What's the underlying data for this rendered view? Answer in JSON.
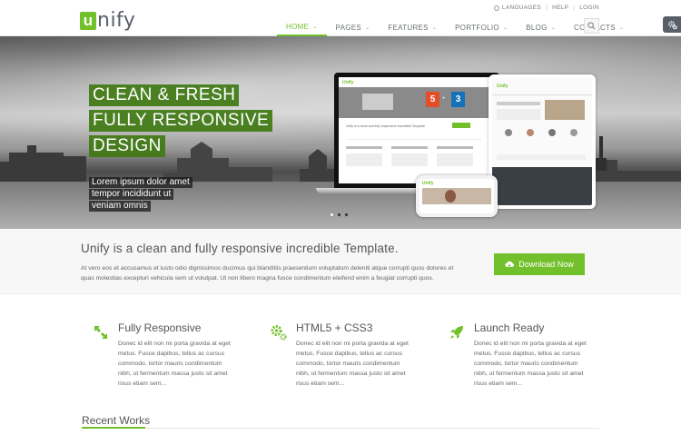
{
  "logo": {
    "letter": "u",
    "text": "nify"
  },
  "topbar": {
    "languages": "LANGUAGES",
    "help": "HELP",
    "login": "LOGIN",
    "separator": "|"
  },
  "nav": {
    "items": [
      {
        "label": "HOME",
        "active": true
      },
      {
        "label": "PAGES"
      },
      {
        "label": "FEATURES"
      },
      {
        "label": "PORTFOLIO"
      },
      {
        "label": "BLOG"
      },
      {
        "label": "CONTACTS"
      }
    ],
    "caret": "⌄"
  },
  "hero": {
    "title_lines": [
      "CLEAN & FRESH",
      "FULLY RESPONSIVE",
      "DESIGN"
    ],
    "subtitle_lines": [
      "Lorem ipsum dolor amet",
      "tempor incididunt ut",
      "veniam omnis"
    ],
    "slide_count": 3,
    "active_slide": 1
  },
  "devices": {
    "laptop_logo": "Unify",
    "laptop_headline": "Unify is a clean and fully responsive Incredible Template",
    "html5": "5",
    "css3": "3",
    "tablet_logo": "Unify",
    "phone_logo": "Unify"
  },
  "promo": {
    "title": "Unify is a clean and fully responsive incredible Template.",
    "text": "At vero eos et accusamus et iusto odio dignissimos ducimus qui blanditiis praesentium voluptatum deleniti atque corrupti quos dolores et quas molestias excepturi vehicula sem ut volutpat. Ut non libero magna fusce condimentum eleifend enim a feugiat corrupti quos.",
    "button": "Download Now"
  },
  "features": [
    {
      "icon": "resize-arrows-icon",
      "title": "Fully Responsive",
      "text": "Donec id elit non mi porta gravida at eget metus. Fusce dapibus, tellus ac cursus commodo, tortor mauris condimentum nibh, ut fermentum massa justo sit amet risus etiam sem..."
    },
    {
      "icon": "gears-icon",
      "title": "HTML5 + CSS3",
      "text": "Donec id elit non mi porta gravida at eget metus. Fusce dapibus, tellus ac cursus commodo, tortor mauris condimentum nibh, ut fermentum massa justo sit amet risus etiam sem..."
    },
    {
      "icon": "rocket-icon",
      "title": "Launch Ready",
      "text": "Donec id elit non mi porta gravida at eget metus. Fusce dapibus, tellus ac cursus commodo, tortor mauris condimentum nibh, ut fermentum massa justo sit amet risus etiam sem..."
    }
  ],
  "recent": {
    "title": "Recent Works"
  },
  "colors": {
    "accent": "#72c02c",
    "dark": "#585f69",
    "hero_title_bg": "#3f7814"
  }
}
